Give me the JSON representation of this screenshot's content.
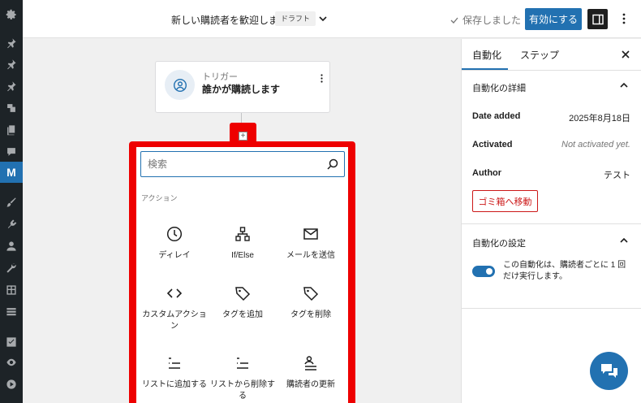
{
  "header": {
    "title": "新しい購読者を歓迎します",
    "status_badge": "ドラフト",
    "saved_label": "保存しました",
    "activate_label": "有効にする"
  },
  "trigger": {
    "label": "トリガー",
    "title": "誰かが購読します"
  },
  "inserter": {
    "search_placeholder": "検索",
    "section_label": "アクション",
    "blocks": [
      {
        "label": "ディレイ",
        "icon": "clock-icon"
      },
      {
        "label": "If/Else",
        "icon": "branch-icon"
      },
      {
        "label": "メールを送信",
        "icon": "envelope-icon"
      },
      {
        "label": "カスタムアクション",
        "icon": "code-icon"
      },
      {
        "label": "タグを追加",
        "icon": "tag-icon"
      },
      {
        "label": "タグを削除",
        "icon": "tag-icon"
      },
      {
        "label": "リストに追加する",
        "icon": "list-icon"
      },
      {
        "label": "リストから削除する",
        "icon": "list-icon"
      },
      {
        "label": "購読者の更新",
        "icon": "user-list-icon"
      }
    ]
  },
  "panel": {
    "tabs": [
      {
        "label": "自動化"
      },
      {
        "label": "ステップ"
      }
    ],
    "details_title": "自動化の詳細",
    "details": [
      {
        "label": "Date added",
        "value": "2025年8月18日"
      },
      {
        "label": "Activated",
        "value": "Not activated yet."
      },
      {
        "label": "Author",
        "value": "テスト"
      }
    ],
    "trash_label": "ゴミ箱へ移動",
    "settings_title": "自動化の設定",
    "toggle_label": "この自動化は、購読者ごとに 1 回だけ実行します。",
    "toggle_on": true
  },
  "colors": {
    "accent": "#2271b1",
    "highlight": "#ee0000",
    "danger": "#cc1818",
    "admin_bar": "#1d2327"
  }
}
